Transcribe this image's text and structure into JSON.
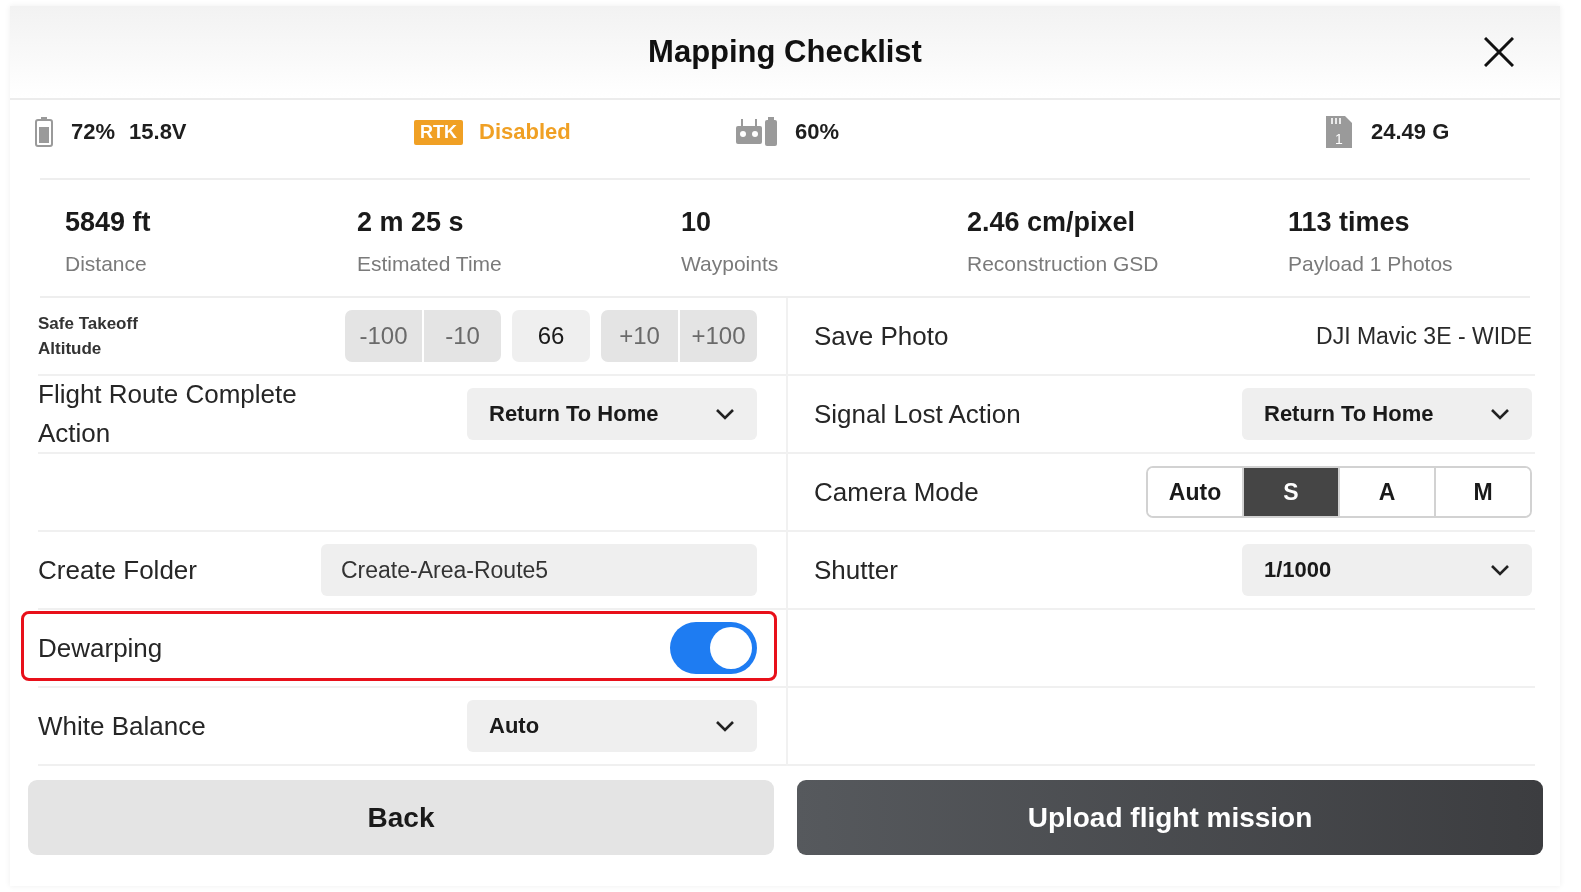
{
  "window": {
    "title": "Mapping Checklist"
  },
  "status_bar": [
    {
      "kind": "battery",
      "texts": [
        "72%",
        "15.8V"
      ]
    },
    {
      "kind": "rtk",
      "badge": "RTK",
      "text": "Disabled",
      "color": "#f0a024"
    },
    {
      "kind": "remote",
      "texts": [
        "60%"
      ]
    },
    {
      "kind": "storage",
      "slot": "1",
      "texts": [
        "24.49 G"
      ]
    }
  ],
  "stats": [
    {
      "value": "5849 ft",
      "label": "Distance"
    },
    {
      "value": "2 m 25 s",
      "label": "Estimated Time"
    },
    {
      "value": "10",
      "label": "Waypoints"
    },
    {
      "value": "2.46 cm/pixel",
      "label": "Reconstruction GSD"
    },
    {
      "value": "113 times",
      "label": "Payload 1 Photos"
    }
  ],
  "settings_left": [
    {
      "kind": "stepper",
      "label": "Safe Takeoff Altitude",
      "decrements": [
        "-100",
        "-10"
      ],
      "value": "66",
      "increments": [
        "+10",
        "+100"
      ],
      "highlighted": false
    },
    {
      "kind": "dropdown",
      "label": "Flight Route Complete Action",
      "value": "Return To Home",
      "highlighted": false
    },
    {
      "kind": "blank",
      "highlighted": false
    },
    {
      "kind": "text_field",
      "label": "Create Folder",
      "value": "Create-Area-Route5",
      "highlighted": false
    },
    {
      "kind": "toggle",
      "label": "Dewarping",
      "on": true,
      "highlighted": true
    },
    {
      "kind": "dropdown",
      "label": "White Balance",
      "value": "Auto",
      "highlighted": false
    }
  ],
  "settings_right": [
    {
      "kind": "info",
      "label": "Save Photo",
      "value": "DJI Mavic 3E - WIDE",
      "highlighted": false
    },
    {
      "kind": "dropdown",
      "label": "Signal Lost Action",
      "value": "Return To Home",
      "highlighted": false
    },
    {
      "kind": "segmented",
      "label": "Camera Mode",
      "options": [
        {
          "label": "Auto",
          "selected": false
        },
        {
          "label": "S",
          "selected": true
        },
        {
          "label": "A",
          "selected": false
        },
        {
          "label": "M",
          "selected": false
        }
      ],
      "highlighted": false
    },
    {
      "kind": "dropdown",
      "label": "Shutter",
      "value": "1/1000",
      "highlighted": false
    },
    {
      "kind": "blank",
      "highlighted": false
    },
    {
      "kind": "blank",
      "highlighted": false
    }
  ],
  "buttons": [
    {
      "label": "Back",
      "kind": "secondary"
    },
    {
      "label": "Upload flight mission",
      "kind": "primary"
    }
  ]
}
